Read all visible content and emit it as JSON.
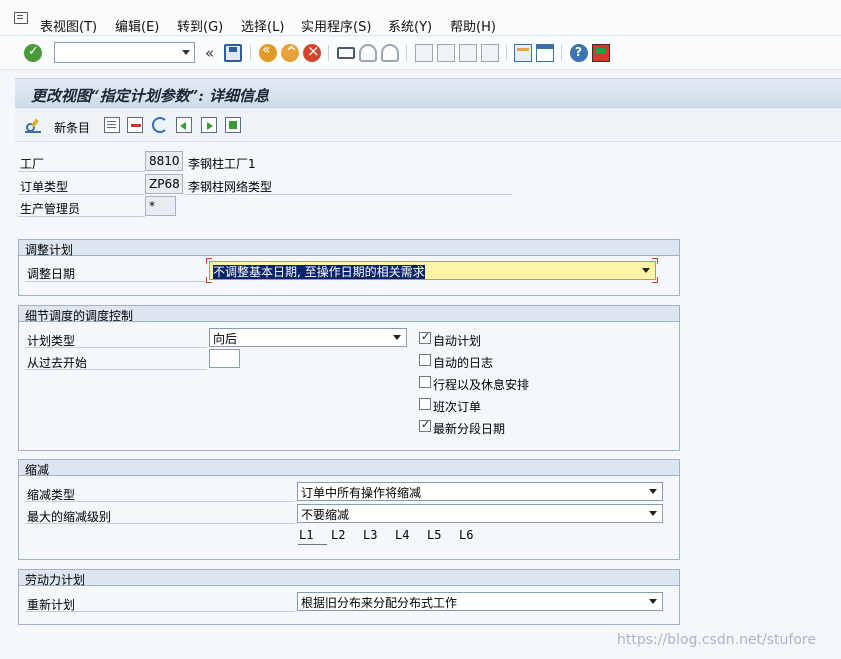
{
  "menu": {
    "items": [
      "表视图(T)",
      "编辑(E)",
      "转到(G)",
      "选择(L)",
      "实用程序(S)",
      "系统(Y)",
      "帮助(H)"
    ]
  },
  "toolbar": {
    "command_field_value": "",
    "icons": [
      "enter-icon",
      "save-icon",
      "back-icon",
      "exit-icon",
      "cancel-icon",
      "print-icon",
      "find-icon",
      "find-next-icon",
      "first-page-icon",
      "previous-page-icon",
      "next-page-icon",
      "last-page-icon",
      "create-session-icon",
      "shortcut-icon",
      "help-icon",
      "customize-layout-icon"
    ]
  },
  "title": "更改视图“指定计划参数”: 详细信息",
  "app_toolbar": {
    "new_entries_label": "新条目"
  },
  "header": {
    "plant_label": "工厂",
    "plant_value": "8810",
    "plant_desc": "李钢柱工厂1",
    "order_type_label": "订单类型",
    "order_type_value": "ZP68",
    "order_type_desc": "李钢柱网络类型",
    "production_supervisor_label": "生产管理员",
    "production_supervisor_value": "*"
  },
  "adjust_scheduling": {
    "title": "调整计划",
    "adjust_dates_label": "调整日期",
    "adjust_dates_value": "不调整基本日期, 至操作日期的相关需求"
  },
  "detailed_scheduling": {
    "title": "细节调度的调度控制",
    "scheduling_type_label": "计划类型",
    "scheduling_type_value": "向后",
    "start_in_past_label": "从过去开始",
    "start_in_past_value": "",
    "checkboxes": [
      {
        "label": "自动计划",
        "checked": true
      },
      {
        "label": "自动的日志",
        "checked": false
      },
      {
        "label": "行程以及休息安排",
        "checked": false
      },
      {
        "label": "班次订单",
        "checked": false
      },
      {
        "label": "最新分段日期",
        "checked": true
      }
    ]
  },
  "reduction": {
    "title": "缩减",
    "reduction_type_label": "缩减类型",
    "reduction_type_value": "订单中所有操作将缩减",
    "max_reduction_level_label": "最大的缩减级别",
    "max_reduction_level_value": "不要缩减",
    "levels": [
      "L1",
      "L2",
      "L3",
      "L4",
      "L5",
      "L6"
    ]
  },
  "workforce_planning": {
    "title": "劳动力计划",
    "rescheduling_label": "重新计划",
    "rescheduling_value": "根据旧分布来分配分布式工作"
  },
  "watermark": "https://blog.csdn.net/stufore",
  "colors": {
    "title_bar": "#d6e1ec",
    "group_header": "#dde6f0",
    "focus_field": "#fdf4a8",
    "selection": "#0a246a"
  }
}
